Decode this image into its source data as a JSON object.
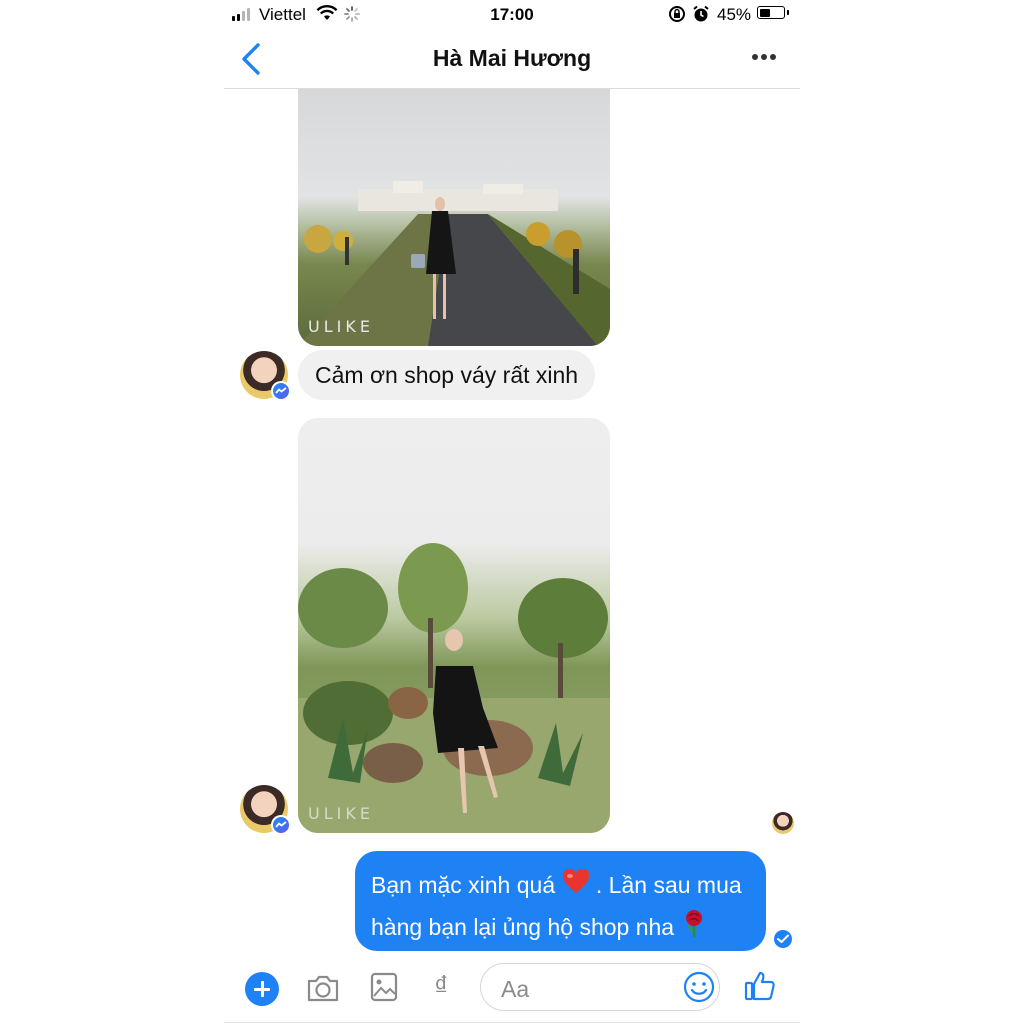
{
  "status_bar": {
    "carrier": "Viettel",
    "time": "17:00",
    "battery_percent": "45%",
    "battery_level": 0.45,
    "signal_bars": 2
  },
  "nav": {
    "title": "Hà Mai Hương",
    "back_icon": "chevron-left-icon",
    "more_icon": "more-dots-icon"
  },
  "messages": [
    {
      "type": "photo",
      "from": "contact",
      "watermark": "ULIKE"
    },
    {
      "type": "text",
      "from": "contact",
      "text": "Cảm ơn shop váy rất xinh"
    },
    {
      "type": "photo",
      "from": "contact",
      "watermark": "ULIKE"
    },
    {
      "type": "text",
      "from": "me",
      "line1_a": "Bạn mặc xinh quá ",
      "line1_emoji": "heart-emoji",
      "line1_b": " . Lần sau mua",
      "line2_a": "hàng bạn lại ủng hộ shop nha ",
      "line2_emoji": "rose-emoji"
    }
  ],
  "composer": {
    "placeholder": "Aa",
    "currency_symbol": "₫",
    "icons": [
      "plus-icon",
      "camera-icon",
      "image-icon",
      "dong-icon",
      "emoji-icon",
      "thumbs-up-icon"
    ]
  },
  "colors": {
    "accent": "#1e82f5",
    "incoming_bubble": "#f0f0f0",
    "text": "#111111"
  }
}
